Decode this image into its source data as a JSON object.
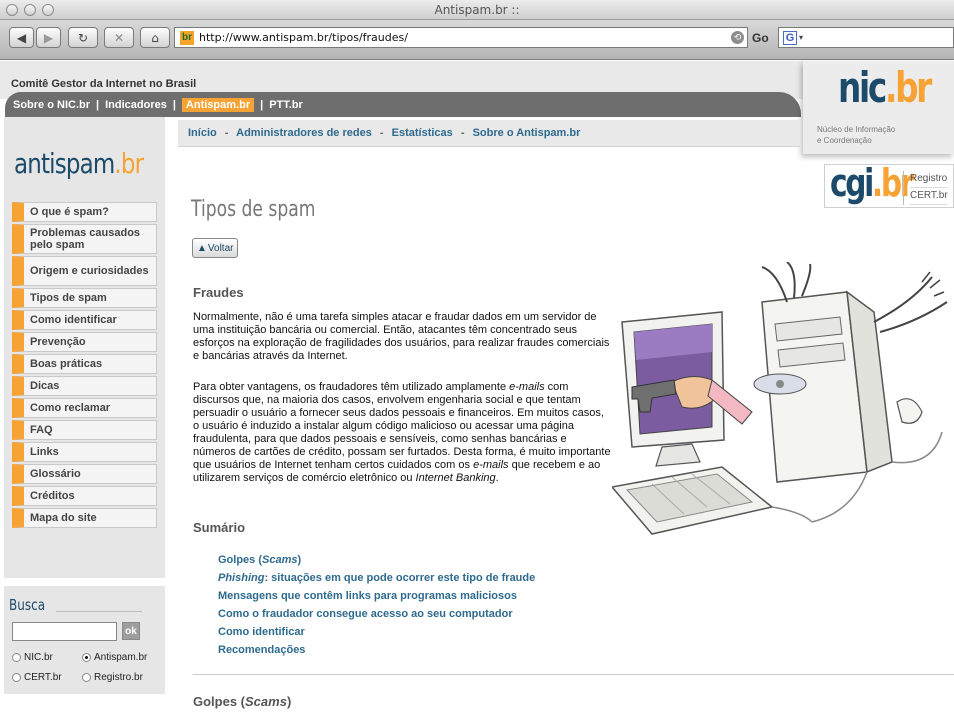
{
  "browser": {
    "window_title": "Antispam.br ::",
    "url": "http://www.antispam.br/tipos/fraudes/",
    "go_label": "Go",
    "google_icon": "G"
  },
  "header": {
    "org_label": "Comitê Gestor da Internet no Brasil",
    "nav": [
      "Sobre o NIC.br",
      "Indicadores",
      "Antispam.br",
      "PTT.br"
    ],
    "nic_logo_a": "nic",
    "nic_logo_b": ".br",
    "nic_sub_1": "Núcleo de Informação",
    "nic_sub_2": "e Coordenação",
    "cgi_logo_a": "cgi",
    "cgi_logo_b": ".br",
    "cgi_links": [
      "Registro",
      "CERT.br"
    ]
  },
  "sidebar": {
    "logo_a": "antispam",
    "logo_b": ".br",
    "menu": [
      "O que é spam?",
      "Problemas causados pelo spam",
      "Origem e curiosidades",
      "Tipos de spam",
      "Como identificar",
      "Prevenção",
      "Boas práticas",
      "Dicas",
      "Como reclamar",
      "FAQ",
      "Links",
      "Glossário",
      "Créditos",
      "Mapa do site"
    ],
    "search_title": "Busca",
    "search_button": "ok",
    "radios": [
      {
        "label": "NIC.br",
        "checked": false
      },
      {
        "label": "Antispam.br",
        "checked": true
      },
      {
        "label": "CERT.br",
        "checked": false
      },
      {
        "label": "Registro.br",
        "checked": false
      }
    ]
  },
  "breadcrumb": [
    "Início",
    "Administradores de redes",
    "Estatísticas",
    "Sobre o Antispam.br"
  ],
  "main": {
    "title": "Tipos de spam",
    "voltar": "Voltar",
    "fraudes_heading": "Fraudes",
    "para1": "Normalmente, não é uma tarefa simples atacar e fraudar dados em um servidor de uma instituição bancária ou comercial. Então, atacantes têm concentrado seus esforços na exploração de fragilidades dos usuários, para realizar fraudes comerciais e bancárias através da Internet.",
    "para2_a": "Para obter vantagens, os fraudadores têm utilizado amplamente ",
    "para2_b": "e-mails",
    "para2_c": " com discursos que, na maioria dos casos, envolvem engenharia social e que tentam persuadir o usuário a fornecer seus dados pessoais e financeiros. Em muitos casos, o usuário é induzido a instalar algum código malicioso ou acessar uma página fraudulenta, para que dados pessoais e sensíveis, como senhas bancárias e números de cartões de crédito, possam ser furtados. Desta forma, é muito importante que usuários de Internet tenham certos cuidados com os ",
    "para2_d": "e-mails",
    "para2_e": " que recebem e ao utilizarem serviços de comércio eletrônico ou ",
    "para2_f": "Internet Banking",
    "para2_g": ".",
    "sumario_heading": "Sumário",
    "sumario": [
      {
        "a": "Golpes (",
        "b": "Scams",
        "c": ")"
      },
      {
        "a": "",
        "b": "Phishing",
        "c": ": situações em que pode ocorrer este tipo de fraude"
      },
      {
        "a": "Mensagens que contêm links para programas maliciosos",
        "b": "",
        "c": ""
      },
      {
        "a": "Como o fraudador consegue acesso ao seu computador",
        "b": "",
        "c": ""
      },
      {
        "a": "Como identificar",
        "b": "",
        "c": ""
      },
      {
        "a": "Recomendações",
        "b": "",
        "c": ""
      }
    ],
    "golpes_heading_a": "Golpes (",
    "golpes_heading_b": "Scams",
    "golpes_heading_c": ")"
  },
  "colors": {
    "accent_orange": "#f7a234",
    "brand_blue": "#1c4a6a",
    "link_blue": "#2e6a8e",
    "nav_gray": "#6e6e6e"
  }
}
